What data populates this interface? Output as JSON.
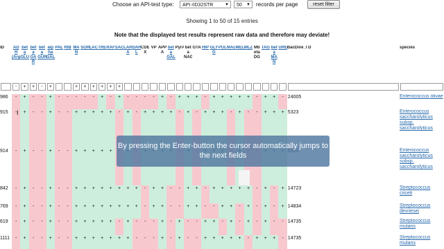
{
  "controls": {
    "api_label": "Choose an API-test type:",
    "api_value": "API rID32STR",
    "page_size": "50",
    "page_size_label": "records per page",
    "reset_label": "reset filter"
  },
  "info": "Showing 1 to 50 of 15 entries",
  "note": "Note that the displayed test results represent raw data and therefore may deviate!",
  "overlay_text": "By pressing the Enter-button the cursor automatically jumps to the next fields",
  "columns": [
    {
      "label": "ID",
      "link": false
    },
    {
      "label": "AD H (Arg)",
      "link": true
    },
    {
      "label": "bet a GLU",
      "link": true
    },
    {
      "label": "bet a GA R",
      "link": true
    },
    {
      "label": "bet a GUR",
      "link": true
    },
    {
      "label": "alp ha GAL",
      "link": true
    },
    {
      "label": "PAL",
      "link": true
    },
    {
      "label": "RIB",
      "link": true
    },
    {
      "label": "MA N",
      "link": true
    },
    {
      "label": "SOR",
      "link": true
    },
    {
      "label": "LAC",
      "link": true
    },
    {
      "label": "TRE",
      "link": true
    },
    {
      "label": "RAF",
      "link": true
    },
    {
      "label": "SAC",
      "link": true
    },
    {
      "label": "LAR A",
      "link": true
    },
    {
      "label": "DAR L",
      "link": true
    },
    {
      "label": "CDE X",
      "link": false
    },
    {
      "label": "VP",
      "link": false
    },
    {
      "label": "APP A",
      "link": false
    },
    {
      "label": "bet a GAL",
      "link": true
    },
    {
      "label": "PyrA",
      "link": false
    },
    {
      "label": "bet a NAG",
      "link": false
    },
    {
      "label": "GTA",
      "link": false
    },
    {
      "label": "HIP",
      "link": true
    },
    {
      "label": "GLY G",
      "link": true
    },
    {
      "label": "PUL",
      "link": true
    },
    {
      "label": "MAL",
      "link": true
    },
    {
      "label": "MEL",
      "link": true
    },
    {
      "label": "MLZ",
      "link": true
    },
    {
      "label": "Mb eta DG",
      "link": false
    },
    {
      "label": "TAG",
      "link": true
    },
    {
      "label": "bet a MA N",
      "link": true
    },
    {
      "label": "URE",
      "link": true
    },
    {
      "label": "BacDive_I D",
      "link": false
    },
    {
      "label": "species",
      "link": false
    }
  ],
  "filters": [
    "",
    "-",
    "+",
    "+",
    "-",
    "+",
    "",
    "",
    "+",
    "+",
    "+",
    "+",
    "+",
    "+",
    "",
    "",
    "",
    "",
    "",
    "",
    "",
    "",
    "",
    "",
    "",
    "",
    "",
    "",
    "",
    "",
    "",
    "",
    "",
    "",
    ""
  ],
  "rows": [
    {
      "id": "986",
      "bacdive": "24005",
      "species": "Enterococcus olivae",
      "values": "-+--+-----+-+----+-+++-+++++-++-++-"
    },
    {
      "id": "915",
      "bacdive": "5323",
      "species": "Enterococcus saccharolyticus subsp. saccharolyticus",
      "values": "-+--+--+++++-+-++++-+-+++-+--+++--+"
    },
    {
      "id": "914",
      "bacdive": "5323",
      "species": "Enterococcus saccharolyticus subsp. saccharolyticus",
      "values": "-+--+--+++++-+-++++-+-+++-+--+++--+"
    },
    {
      "id": "842",
      "bacdive": "14723",
      "species": "Streptococcus criceti",
      "values": "-+--+--++++++++-++--++-+++++-+-++-+"
    },
    {
      "id": "769",
      "bacdive": "14834",
      "species": "Streptococcus devriesei",
      "values": "-+--+--++++++++-++--++--++-+-+-++-+"
    },
    {
      "id": "619",
      "bacdive": "14735",
      "species": "Streptococcus mutans",
      "values": "-+--+--+++++-+---+-+--++-+-+-+---+-"
    },
    {
      "id": "1111",
      "bacdive": "14735",
      "species": "Streptococcus mutans",
      "values": "-+--+--+++++++---+-+--+++++-+++-+++"
    }
  ],
  "colors": {
    "positive": "#cdeedd",
    "negative": "#f8c8cf",
    "link": "#2266aa",
    "overlay": "#5078a0"
  }
}
